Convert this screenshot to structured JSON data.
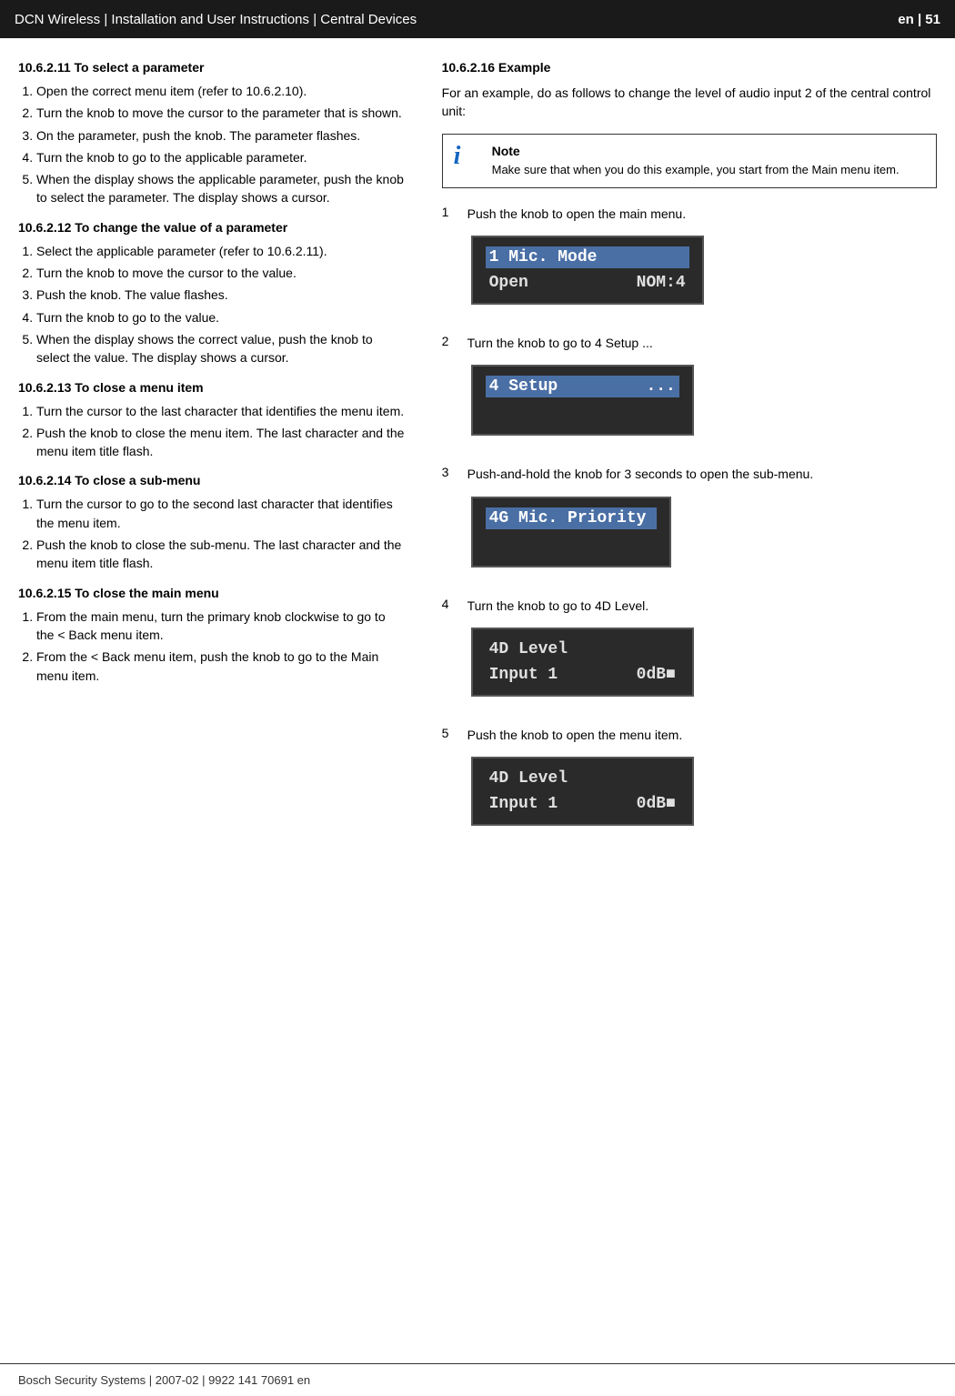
{
  "header": {
    "brand": "DCN Wireless",
    "separator1": " | ",
    "doc_title": "Installation and User Instructions",
    "separator2": " | ",
    "section": "Central Devices",
    "page_info": "en | 51"
  },
  "footer": {
    "text": "Bosch Security Systems | 2007-02 | 9922 141 70691 en"
  },
  "left_col": {
    "sections": [
      {
        "id": "10.6.2.11",
        "heading": "10.6.2.11  To select a parameter",
        "steps": [
          "Open the correct menu item (refer to 10.6.2.10).",
          "Turn the knob to move the cursor to the parameter that is shown.",
          "On the parameter, push the knob. The parameter flashes.",
          "Turn the knob to go to the applicable parameter.",
          "When the display shows the applicable parameter, push the knob to select the parameter. The display shows a cursor."
        ]
      },
      {
        "id": "10.6.2.12",
        "heading": "10.6.2.12  To change the value of a parameter",
        "steps": [
          "Select the applicable parameter (refer to 10.6.2.11).",
          "Turn the knob to move the cursor to the value.",
          "Push the knob. The value flashes.",
          "Turn the knob to go to the value.",
          "When the display shows the correct value, push the knob to select the value. The display shows a cursor."
        ]
      },
      {
        "id": "10.6.2.13",
        "heading": "10.6.2.13  To close a menu item",
        "steps": [
          "Turn the cursor to the last character that identifies the menu item.",
          "Push the knob to close the menu item. The last character and the menu item title flash."
        ]
      },
      {
        "id": "10.6.2.14",
        "heading": "10.6.2.14  To close a sub-menu",
        "steps": [
          "Turn the cursor to go to the second last character that identifies the menu item.",
          "Push the knob to close the sub-menu. The last character and the menu item title flash."
        ]
      },
      {
        "id": "10.6.2.15",
        "heading": "10.6.2.15  To close the main menu",
        "steps": [
          "From the main menu, turn the primary knob clockwise to go to the < Back menu item.",
          "From the < Back menu item, push the knob to go to the Main menu item."
        ]
      }
    ]
  },
  "right_col": {
    "section_id": "10.6.2.16",
    "section_heading": "10.6.2.16  Example",
    "intro": "For an example, do as follows to change the level of audio input 2 of the central control unit:",
    "note": {
      "title": "Note",
      "text": "Make sure that when you do this example, you start from the Main menu item."
    },
    "steps": [
      {
        "num": "1",
        "text": "Push the knob to open the main menu.",
        "lcd": {
          "row1": "1 Mic. Mode",
          "row2": "Open            NOM:4",
          "highlight_row": 1
        }
      },
      {
        "num": "2",
        "text": "Turn the knob to go to 4 Setup ...",
        "lcd": {
          "row1": "4 Setup         ...",
          "row2": "",
          "highlight_row": 1
        }
      },
      {
        "num": "3",
        "text": "Push-and-hold the knob for 3 seconds to open the sub-menu.",
        "lcd": {
          "row1": "4G Mic. Priority",
          "row2": "",
          "highlight_row": 1
        }
      },
      {
        "num": "4",
        "text": "Turn the knob to go to 4D Level.",
        "lcd": {
          "row1": "4D Level",
          "row2": "Input 1         0dB■",
          "highlight_row": 0
        }
      },
      {
        "num": "5",
        "text": "Push the knob to open the menu item.",
        "lcd": {
          "row1": "4D Level",
          "row2": "Input 1         0dB■",
          "highlight_row": 0
        }
      }
    ]
  }
}
